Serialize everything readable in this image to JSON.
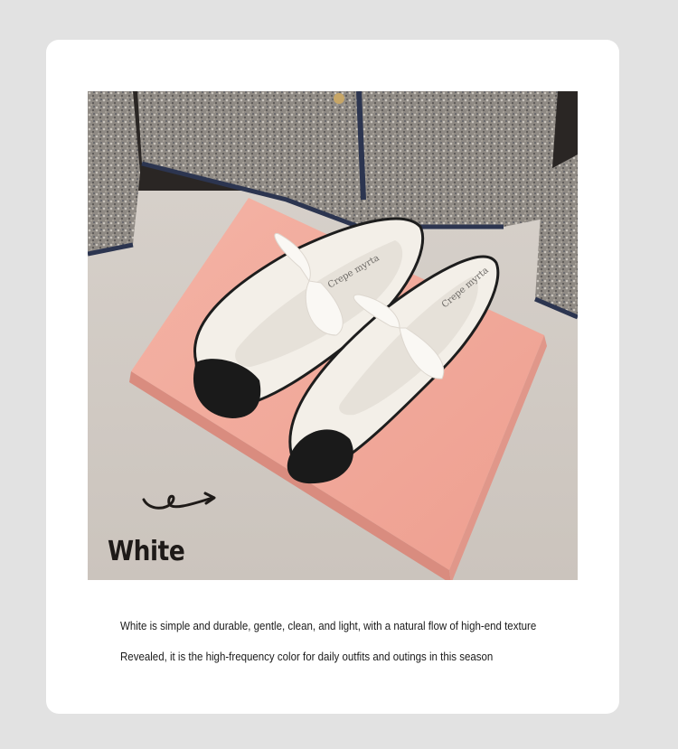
{
  "product": {
    "color_name": "White",
    "box_brand_text": "Crepe myrta",
    "description_lines": [
      "White is simple and durable, gentle, clean, and light, with a natural flow of high-end texture",
      "Revealed, it is the high-frequency color for daily outfits and outings in this season"
    ]
  },
  "colors": {
    "page_background": "#e2e2e2",
    "card_background": "#ffffff",
    "box_pink": "#f2a89a",
    "shoe_white": "#f3efe8",
    "toe_cap_black": "#1a1a1a",
    "tweed_gray": "#8a8580",
    "tweed_trim_navy": "#2c3550"
  },
  "icons": [
    "curly-arrow-icon"
  ]
}
